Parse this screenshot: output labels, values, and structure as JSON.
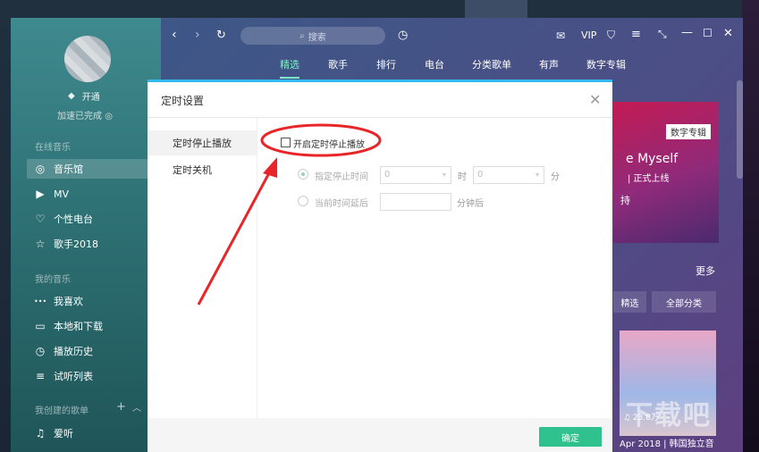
{
  "sidebar": {
    "vip_label": "开通",
    "accel_label": "加速已完成",
    "sections": [
      "在线音乐",
      "我的音乐",
      "我创建的歌单"
    ],
    "online_items": [
      {
        "label": "音乐馆",
        "icon": "music-hall-icon",
        "glyph": "◎"
      },
      {
        "label": "MV",
        "icon": "mv-icon",
        "glyph": "▶"
      },
      {
        "label": "个性电台",
        "icon": "heart-radio-icon",
        "glyph": "♡"
      },
      {
        "label": "歌手2018",
        "icon": "star-icon",
        "glyph": "☆"
      }
    ],
    "my_items": [
      {
        "label": "我喜欢",
        "icon": "dots-icon",
        "glyph": "•••"
      },
      {
        "label": "本地和下载",
        "icon": "monitor-icon",
        "glyph": "▭"
      },
      {
        "label": "播放历史",
        "icon": "clock-icon",
        "glyph": "◷"
      },
      {
        "label": "试听列表",
        "icon": "list-icon",
        "glyph": "≡"
      }
    ],
    "playlist_item": {
      "label": "爱听",
      "glyph": "♫"
    }
  },
  "topbar": {
    "search_placeholder": "搜索",
    "vip": "VIP",
    "tabs": [
      "精选",
      "歌手",
      "排行",
      "电台",
      "分类歌单",
      "有声",
      "数字专辑"
    ]
  },
  "content": {
    "badge": "数字专辑",
    "banner_title": "e Myself",
    "banner_sub": "| 正式上线",
    "banner_btn": "持",
    "more": "更多",
    "btn_featured": "精选",
    "btn_all": "全部分类",
    "play_count": "23.8万",
    "song_caption": "Apr 2018 | 韩国独立音"
  },
  "modal": {
    "title": "定时设置",
    "nav": [
      "定时停止播放",
      "定时关机"
    ],
    "enable_label": "开启定时停止播放",
    "opt1_label": "指定停止时间",
    "hour_value": "0",
    "hour_unit": "时",
    "min_value": "0",
    "min_unit": "分",
    "opt2_label": "当前时间延后",
    "delay_unit": "分钟后",
    "ok_label": "确定"
  },
  "watermark": "下载吧",
  "colors": {
    "accent": "#2fc18e",
    "tab_active": "#7ef0c6",
    "annotation": "#e8262a",
    "modal_bar": "#33b8f0"
  }
}
